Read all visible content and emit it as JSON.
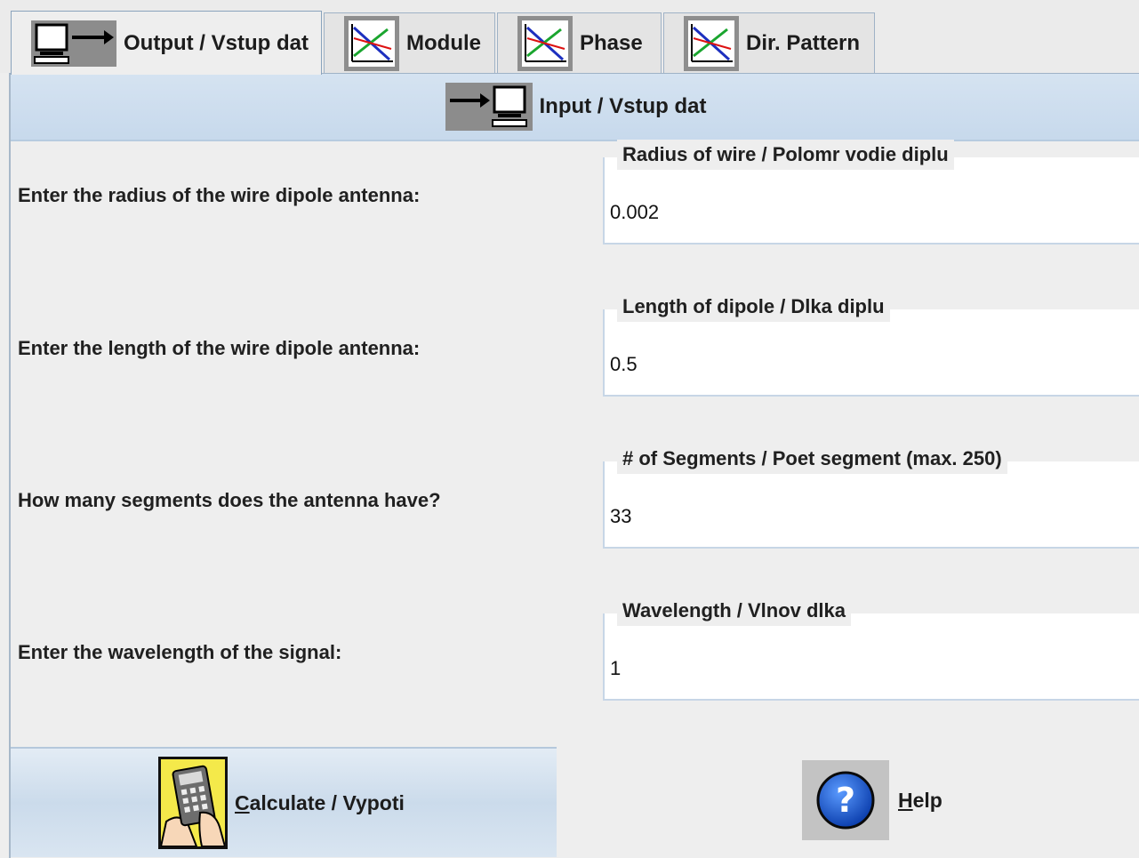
{
  "tabs": [
    {
      "id": "output",
      "label": "Output / Vstup dat",
      "icon": "monitor-arrow-out-icon",
      "active": true
    },
    {
      "id": "module",
      "label": "Module",
      "icon": "graph-plot-icon",
      "active": false
    },
    {
      "id": "phase",
      "label": "Phase",
      "icon": "graph-plot-icon",
      "active": false
    },
    {
      "id": "dir",
      "label": "Dir. Pattern",
      "icon": "graph-plot-icon",
      "active": false
    }
  ],
  "inner_tab": {
    "label": "Input / Vstup dat",
    "icon": "arrow-into-monitor-icon"
  },
  "form": {
    "radius": {
      "prompt": "Enter the radius of the wire dipole antenna:",
      "legend": "Radius of wire / Polomr vodie diplu",
      "value": "0.002"
    },
    "length": {
      "prompt": "Enter the length of the wire dipole antenna:",
      "legend": "Length of dipole / Dlka diplu",
      "value": "0.5"
    },
    "segments": {
      "prompt": "How many segments does the antenna have?",
      "legend": "# of Segments / Poet segment  (max. 250)",
      "value": "33"
    },
    "wavelength": {
      "prompt": "Enter the wavelength of the signal:",
      "legend": "Wavelength / Vlnov dlka",
      "value": "1"
    }
  },
  "buttons": {
    "calculate": {
      "mnemonic": "C",
      "rest": "alculate / Vypoti",
      "icon": "calculator-hand-icon"
    },
    "help": {
      "mnemonic": "H",
      "rest": "elp",
      "icon": "question-mark-icon"
    }
  },
  "colors": {
    "tab_active_bg": "#eeeeee",
    "inner_tab_bg": "#cbdcee",
    "help_blue": "#1f5fd8",
    "calc_yellow": "#f4e94a"
  }
}
